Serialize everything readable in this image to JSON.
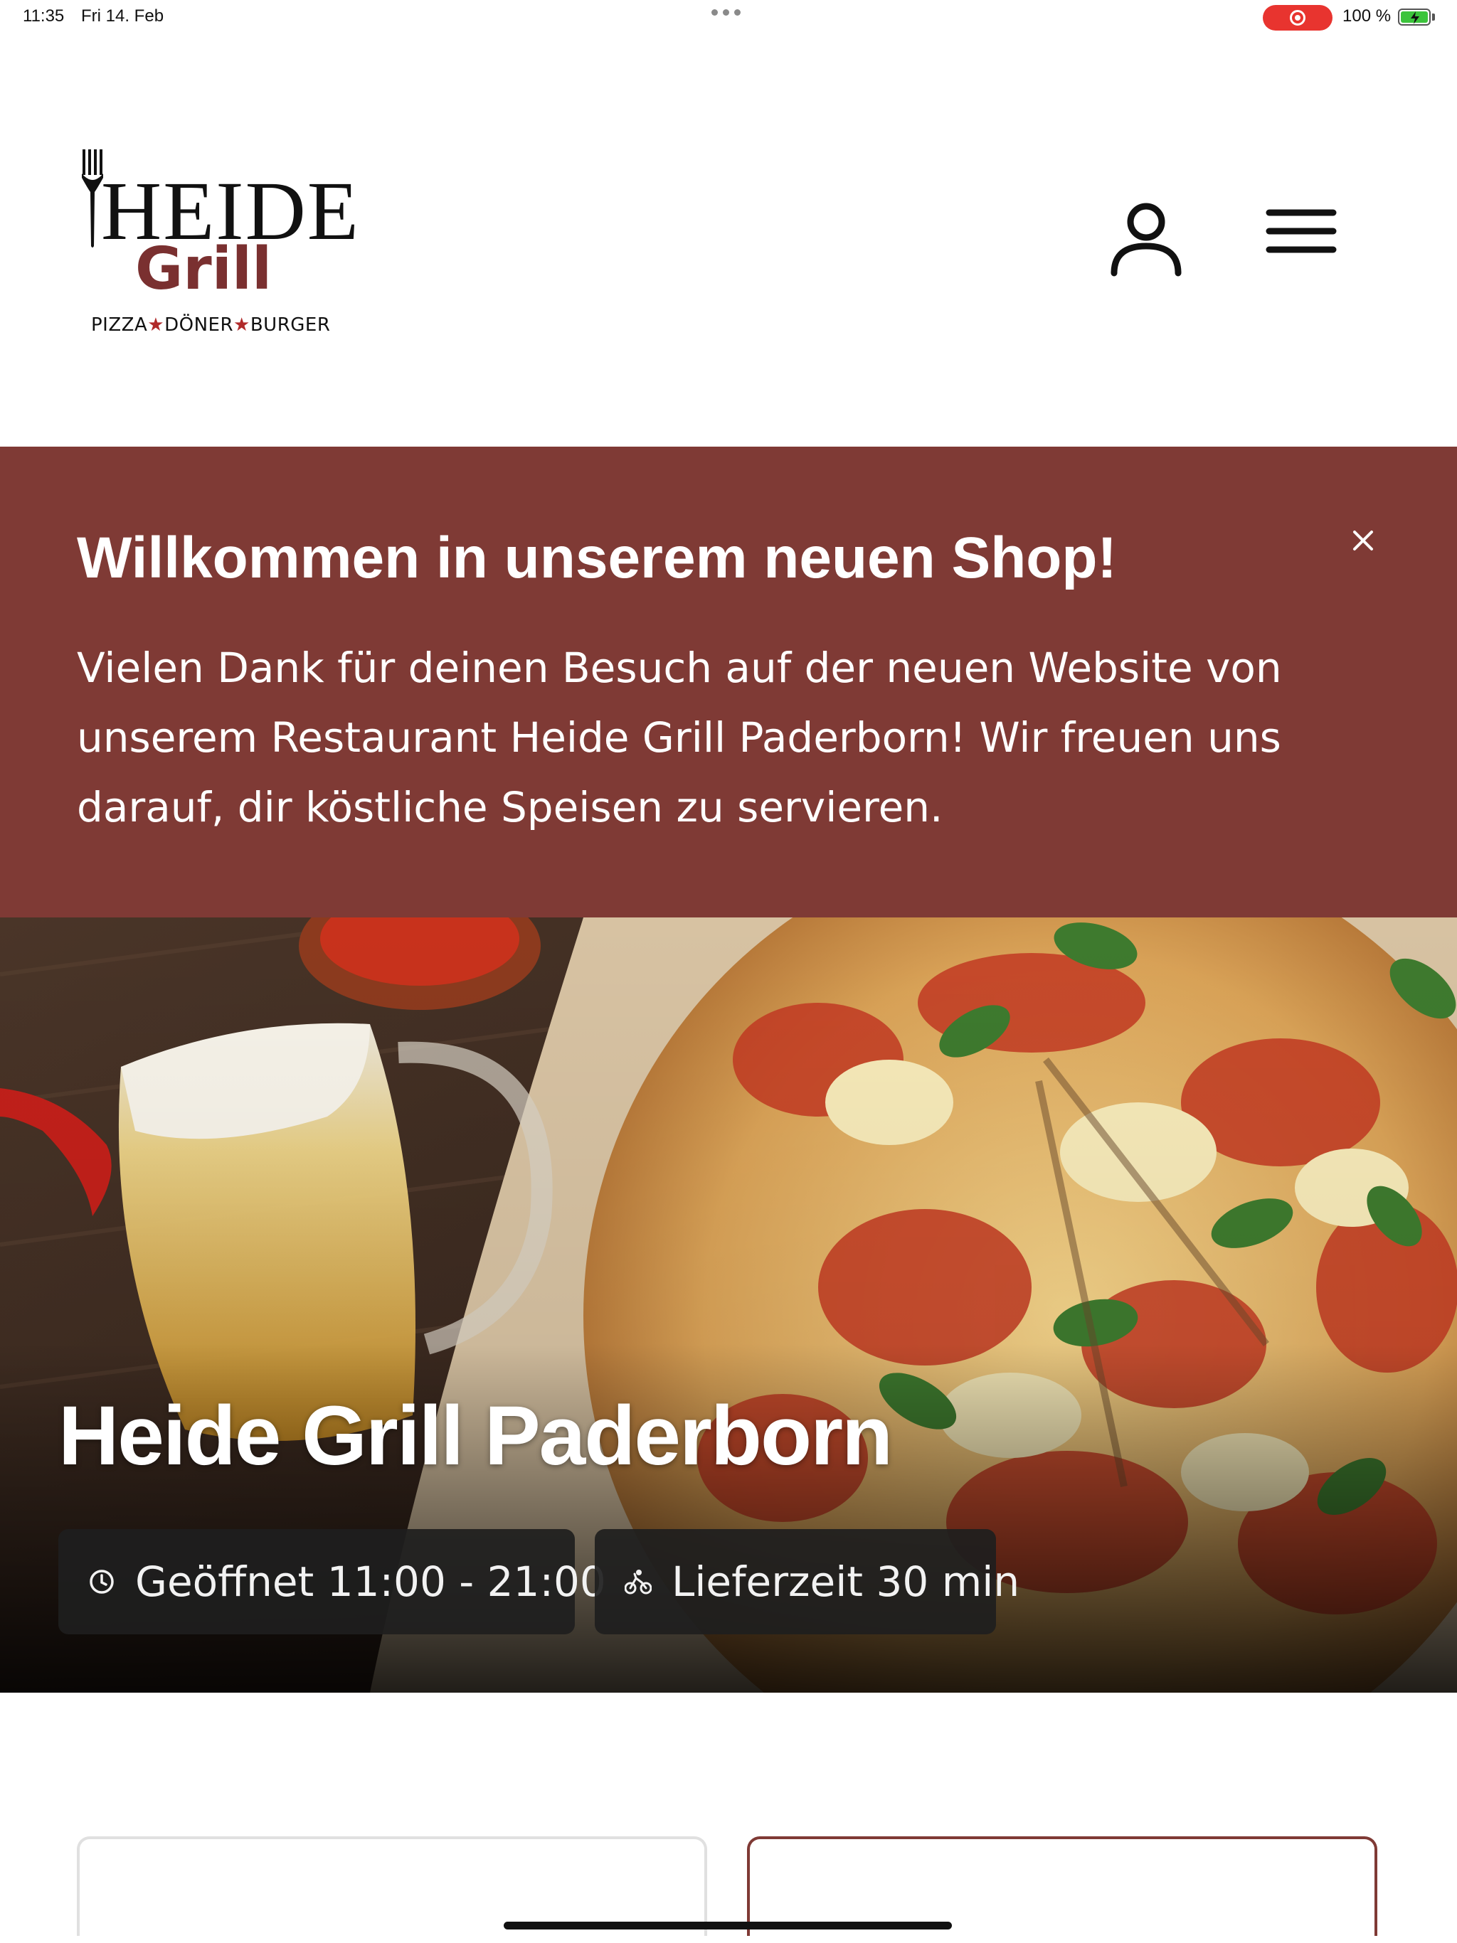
{
  "status_bar": {
    "time": "11:35",
    "date": "Fri 14. Feb",
    "battery_text": "100 %",
    "recording_indicator": "record-icon",
    "colors": {
      "record": "#e8342f",
      "battery": "#3cc43c"
    }
  },
  "header": {
    "logo": {
      "brand_line1": "HEIDE",
      "brand_line2": "Grill",
      "tagline_part1": "PIZZA",
      "tagline_part2": "DÖNER",
      "tagline_part3": "BURGER"
    },
    "account_icon": "user-icon",
    "menu_icon": "hamburger-menu-icon"
  },
  "welcome_banner": {
    "title": "Willkommen in unserem neuen Shop!",
    "body": "Vielen Dank für deinen Besuch auf der neuen Website von unserem Restaurant Heide Grill Paderborn! Wir freuen uns darauf, dir köstliche Speisen zu servieren.",
    "close_icon": "close-icon",
    "background_color": "#7f3a35"
  },
  "hero": {
    "title": "Heide Grill Paderborn",
    "opening_hours": "Geöffnet 11:00 - 21:00",
    "delivery_time": "Lieferzeit 30 min",
    "hours_icon": "clock-icon",
    "delivery_icon": "bike-courier-icon"
  },
  "theme": {
    "accent": "#7f3a35",
    "brand_red": "#b02a2a"
  }
}
